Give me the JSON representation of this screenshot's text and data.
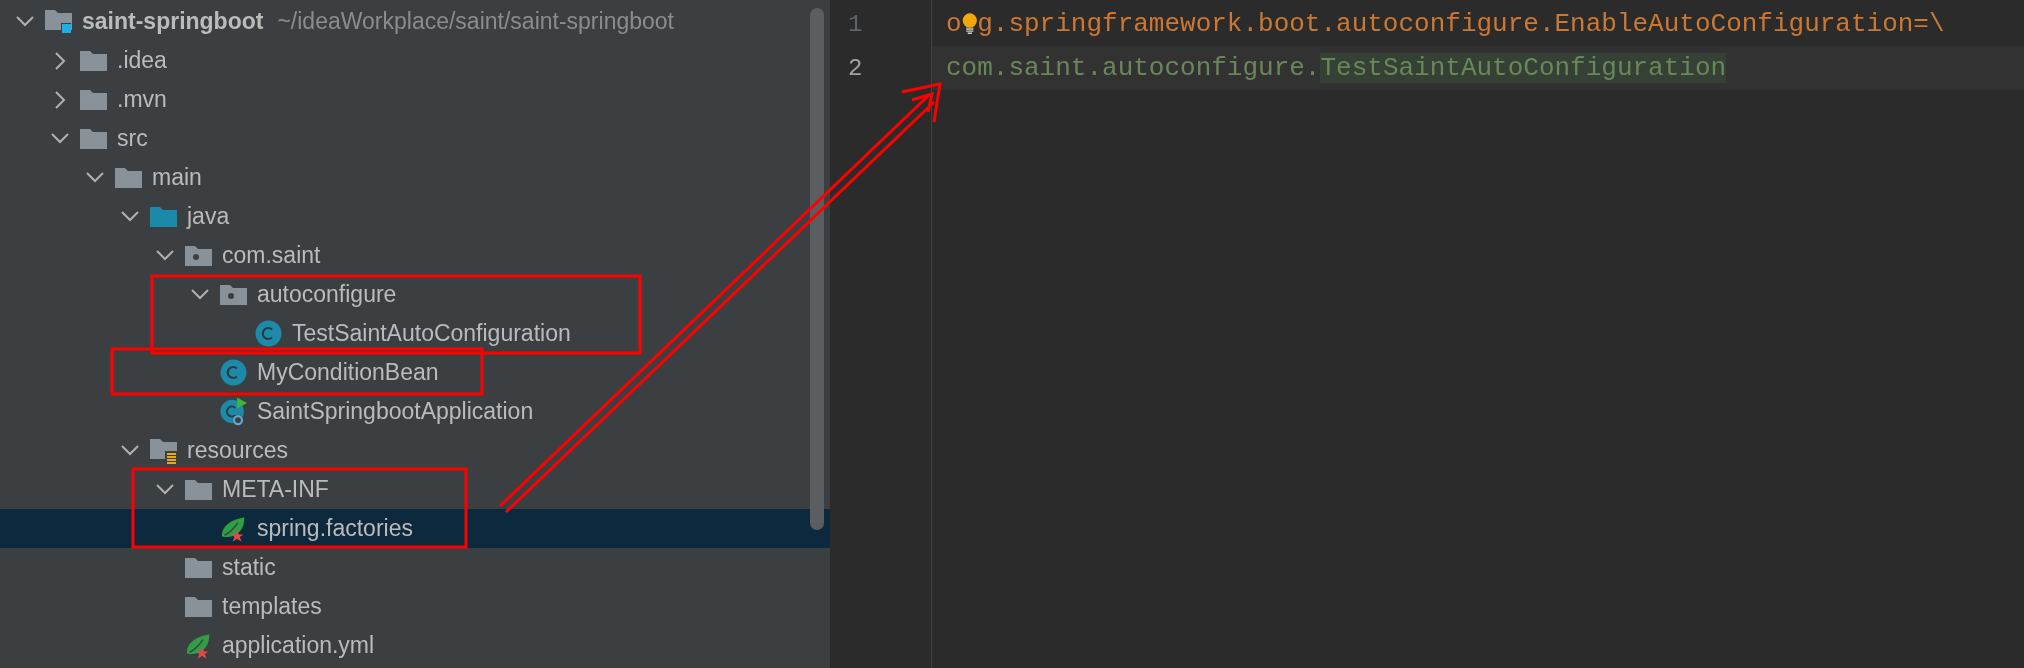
{
  "tree": {
    "items": [
      {
        "name": "saint-springboot",
        "path": "~/ideaWorkplace/saint/saint-springboot",
        "kind": "module",
        "expanded": true,
        "selected": false,
        "children": [
          {
            "name": ".idea",
            "kind": "folder",
            "expanded": false,
            "selected": false
          },
          {
            "name": ".mvn",
            "kind": "folder",
            "expanded": false,
            "selected": false
          },
          {
            "name": "src",
            "kind": "folder",
            "expanded": true,
            "selected": false,
            "children": [
              {
                "name": "main",
                "kind": "folder",
                "expanded": true,
                "selected": false,
                "children": [
                  {
                    "name": "java",
                    "kind": "source-folder",
                    "expanded": true,
                    "selected": false,
                    "children": [
                      {
                        "name": "com.saint",
                        "kind": "package",
                        "expanded": true,
                        "selected": false,
                        "children": [
                          {
                            "name": "autoconfigure",
                            "kind": "package",
                            "expanded": true,
                            "selected": false,
                            "children": [
                              {
                                "name": "TestSaintAutoConfiguration",
                                "kind": "class",
                                "selected": false
                              }
                            ]
                          },
                          {
                            "name": "MyConditionBean",
                            "kind": "class",
                            "selected": false
                          },
                          {
                            "name": "SaintSpringbootApplication",
                            "kind": "boot-class",
                            "selected": false
                          }
                        ]
                      }
                    ]
                  },
                  {
                    "name": "resources",
                    "kind": "resources-folder",
                    "expanded": true,
                    "selected": false,
                    "children": [
                      {
                        "name": "META-INF",
                        "kind": "folder",
                        "expanded": true,
                        "selected": false,
                        "children": [
                          {
                            "name": "spring.factories",
                            "kind": "spring-file",
                            "selected": true
                          }
                        ]
                      },
                      {
                        "name": "static",
                        "kind": "folder",
                        "selected": false
                      },
                      {
                        "name": "templates",
                        "kind": "folder",
                        "selected": false
                      },
                      {
                        "name": "application.yml",
                        "kind": "spring-file",
                        "selected": false
                      }
                    ]
                  }
                ]
              }
            ]
          }
        ]
      }
    ]
  },
  "editor": {
    "lines": [
      {
        "number": "1",
        "current": false,
        "tokens": [
          {
            "kind": "key",
            "text": "o"
          },
          {
            "kind": "bulb"
          },
          {
            "kind": "key",
            "text": "g.springframework.boot.autoconfigure.EnableAutoConfiguration=\\"
          }
        ]
      },
      {
        "number": "2",
        "current": true,
        "tokens": [
          {
            "kind": "value",
            "text": "com.saint.autoconfigure.",
            "highlight": false
          },
          {
            "kind": "value",
            "text": "TestSaintAutoConfiguration",
            "highlight": true
          }
        ]
      }
    ]
  },
  "annotations": [
    {
      "kind": "box"
    },
    {
      "kind": "box"
    },
    {
      "kind": "box"
    },
    {
      "kind": "arrow"
    }
  ]
}
